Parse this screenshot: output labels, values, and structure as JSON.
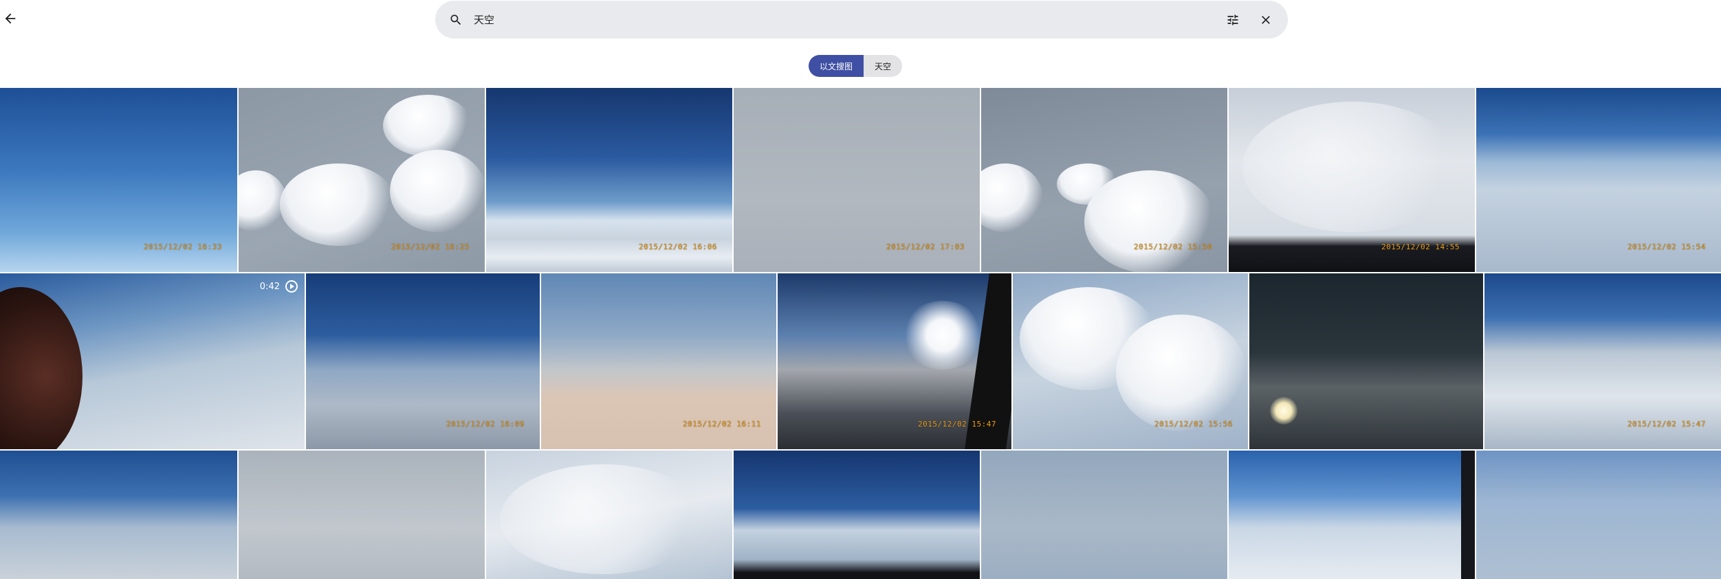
{
  "toolbar": {
    "back_icon": "arrow-back-icon"
  },
  "search": {
    "query": "天空",
    "search_icon": "search-icon",
    "filter_icon": "tune-icon",
    "clear_icon": "close-icon"
  },
  "chips": {
    "text_to_image": "以文搜图",
    "keyword": "天空"
  },
  "photos": [
    {
      "timestamp": "2015/12/02 16:33"
    },
    {
      "timestamp": "2015/12/02 16:25"
    },
    {
      "timestamp": "2015/12/02 16:06"
    },
    {
      "timestamp": "2015/12/02 17:03"
    },
    {
      "timestamp": "2015/12/02 15:50"
    },
    {
      "timestamp": "2015/12/02 14:55"
    },
    {
      "timestamp": "2015/12/02 15:54"
    },
    {
      "duration": "0:42",
      "icon": "play-circle-icon"
    },
    {
      "timestamp": "2015/12/02 16:09"
    },
    {
      "timestamp": "2015/12/02 16:11"
    },
    {
      "timestamp": "2015/12/02 15:47"
    },
    {
      "timestamp": "2015/12/02 15:56"
    },
    {
      "timestamp": ""
    },
    {
      "timestamp": "2015/12/02 15:47"
    },
    {
      "timestamp": ""
    },
    {
      "timestamp": ""
    },
    {
      "timestamp": ""
    },
    {
      "timestamp": ""
    },
    {
      "timestamp": ""
    },
    {
      "timestamp": ""
    },
    {
      "timestamp": ""
    }
  ],
  "colors": {
    "accent": "#3f4fa3",
    "search_bg": "#e9eaee",
    "timestamp": "#f0a21e"
  }
}
